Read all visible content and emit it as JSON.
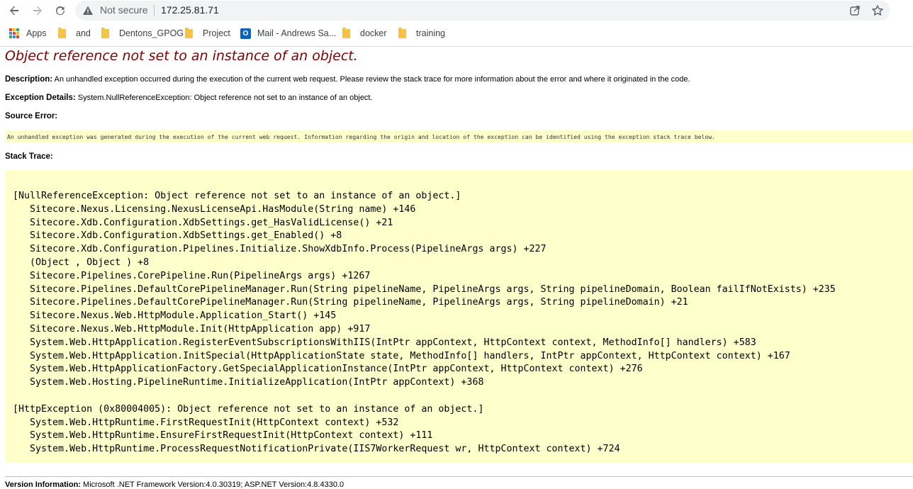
{
  "browser": {
    "security_label": "Not secure",
    "url": "172.25.81.71",
    "icons": [
      "back-icon",
      "forward-icon",
      "reload-icon",
      "warning-icon",
      "share-icon",
      "star-icon"
    ]
  },
  "bookmarks": [
    {
      "label": "Apps",
      "icon": "apps-grid-icon"
    },
    {
      "label": "and",
      "icon": "folder-icon"
    },
    {
      "label": "Dentons_GPOG",
      "icon": "folder-icon"
    },
    {
      "label": "Project",
      "icon": "folder-icon"
    },
    {
      "label": "Mail - Andrews Sa...",
      "icon": "outlook-icon"
    },
    {
      "label": "docker",
      "icon": "folder-icon"
    },
    {
      "label": "training",
      "icon": "folder-icon"
    }
  ],
  "page": {
    "title": "Object reference not set to an instance of an object.",
    "description_label": "Description:",
    "description_text": "An unhandled exception occurred during the execution of the current web request. Please review the stack trace for more information about the error and where it originated in the code.",
    "exception_label": "Exception Details:",
    "exception_text": "System.NullReferenceException: Object reference not set to an instance of an object.",
    "source_error_label": "Source Error:",
    "source_error_text": "An unhandled exception was generated during the execution of the current web request. Information regarding the origin and location of the exception can be identified using the exception stack trace below.",
    "stack_trace_label": "Stack Trace:",
    "stack_lines": [
      "[NullReferenceException: Object reference not set to an instance of an object.]",
      "   Sitecore.Nexus.Licensing.NexusLicenseApi.HasModule(String name) +146",
      "   Sitecore.Xdb.Configuration.XdbSettings.get_HasValidLicense() +21",
      "   Sitecore.Xdb.Configuration.XdbSettings.get_Enabled() +8",
      "   Sitecore.Xdb.Configuration.Pipelines.Initialize.ShowXdbInfo.Process(PipelineArgs args) +227",
      "   (Object , Object ) +8",
      "   Sitecore.Pipelines.CorePipeline.Run(PipelineArgs args) +1267",
      "   Sitecore.Pipelines.DefaultCorePipelineManager.Run(String pipelineName, PipelineArgs args, String pipelineDomain, Boolean failIfNotExists) +235",
      "   Sitecore.Pipelines.DefaultCorePipelineManager.Run(String pipelineName, PipelineArgs args, String pipelineDomain) +21",
      "   Sitecore.Nexus.Web.HttpModule.Application_Start() +145",
      "   Sitecore.Nexus.Web.HttpModule.Init(HttpApplication app) +917",
      "   System.Web.HttpApplication.RegisterEventSubscriptionsWithIIS(IntPtr appContext, HttpContext context, MethodInfo[] handlers) +583",
      "   System.Web.HttpApplication.InitSpecial(HttpApplicationState state, MethodInfo[] handlers, IntPtr appContext, HttpContext context) +167",
      "   System.Web.HttpApplicationFactory.GetSpecialApplicationInstance(IntPtr appContext, HttpContext context) +276",
      "   System.Web.Hosting.PipelineRuntime.InitializeApplication(IntPtr appContext) +368",
      "",
      "[HttpException (0x80004005): Object reference not set to an instance of an object.]",
      "   System.Web.HttpRuntime.FirstRequestInit(HttpContext context) +532",
      "   System.Web.HttpRuntime.EnsureFirstRequestInit(HttpContext context) +111",
      "   System.Web.HttpRuntime.ProcessRequestNotificationPrivate(IIS7WorkerRequest wr, HttpContext context) +724"
    ],
    "version_label": "Version Information:",
    "version_text": "Microsoft .NET Framework Version:4.0.30319; ASP.NET Version:4.8.4330.0"
  }
}
